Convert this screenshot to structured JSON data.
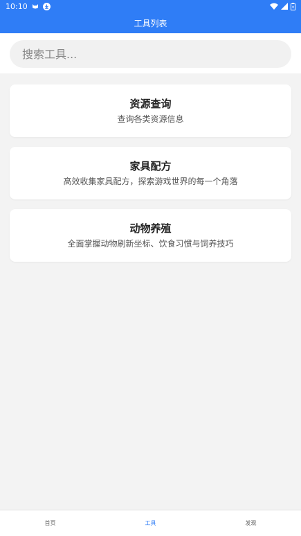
{
  "status_bar": {
    "time": "10:10"
  },
  "app_bar": {
    "title": "工具列表"
  },
  "search": {
    "placeholder": "搜索工具..."
  },
  "tools": [
    {
      "title": "资源查询",
      "description": "查询各类资源信息"
    },
    {
      "title": "家具配方",
      "description": "高效收集家具配方，探索游戏世界的每一个角落"
    },
    {
      "title": "动物养殖",
      "description": "全面掌握动物刷新坐标、饮食习惯与饲养技巧"
    }
  ],
  "bottom_nav": {
    "items": [
      {
        "label": "首页"
      },
      {
        "label": "工具"
      },
      {
        "label": "发现"
      }
    ],
    "active_color": "#2f7df6"
  },
  "colors": {
    "primary": "#2f7df6",
    "background": "#f3f3f3"
  }
}
